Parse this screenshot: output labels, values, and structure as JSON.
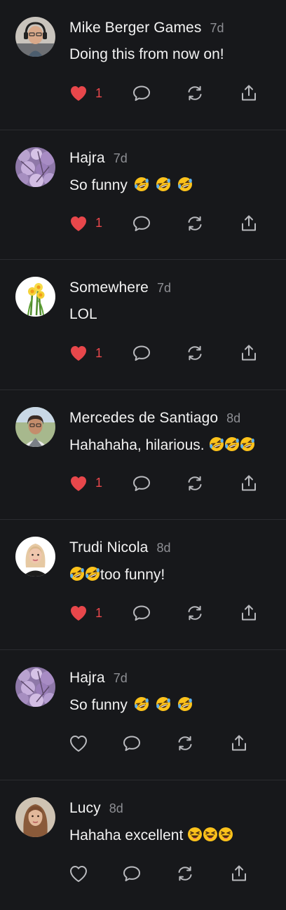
{
  "comments": [
    {
      "author": "Mike Berger Games",
      "time": "7d",
      "text": "Doing this from now on!",
      "emojis": [],
      "emoji_spaced": false,
      "liked": true,
      "like_count": "1",
      "avatar": "avatar-man-headphones"
    },
    {
      "author": "Hajra",
      "time": "7d",
      "text": "So funny",
      "emojis": [
        "rofl",
        "rofl",
        "rofl"
      ],
      "emoji_spaced": true,
      "liked": true,
      "like_count": "1",
      "avatar": "avatar-blossom"
    },
    {
      "author": "Somewhere",
      "time": "7d",
      "text": "LOL",
      "emojis": [],
      "emoji_spaced": false,
      "liked": true,
      "like_count": "1",
      "avatar": "avatar-daffodils"
    },
    {
      "author": "Mercedes de Santiago",
      "time": "8d",
      "text": "Hahahaha, hilarious.",
      "emojis": [
        "rofl",
        "rofl",
        "rofl"
      ],
      "emoji_spaced": false,
      "liked": true,
      "like_count": "1",
      "avatar": "avatar-woman-outdoor"
    },
    {
      "author": "Trudi Nicola",
      "time": "8d",
      "text": "too funny!",
      "emojis_before": [
        "rofl",
        "rofl"
      ],
      "emojis": [],
      "emoji_spaced": false,
      "liked": true,
      "like_count": "1",
      "avatar": "avatar-woman-blonde"
    },
    {
      "author": "Hajra",
      "time": "7d",
      "text": "So funny",
      "emojis": [
        "rofl",
        "rofl",
        "rofl"
      ],
      "emoji_spaced": true,
      "liked": false,
      "like_count": "",
      "avatar": "avatar-blossom"
    },
    {
      "author": "Lucy",
      "time": "8d",
      "text": "Hahaha excellent",
      "emojis": [
        "laughing",
        "laughing",
        "laughing"
      ],
      "emoji_spaced": false,
      "liked": false,
      "like_count": "",
      "avatar": "avatar-woman-longhair"
    }
  ],
  "colors": {
    "background": "#17181b",
    "liked": "#e8474b",
    "icon": "#b9babe",
    "muted": "#8e8f94"
  }
}
